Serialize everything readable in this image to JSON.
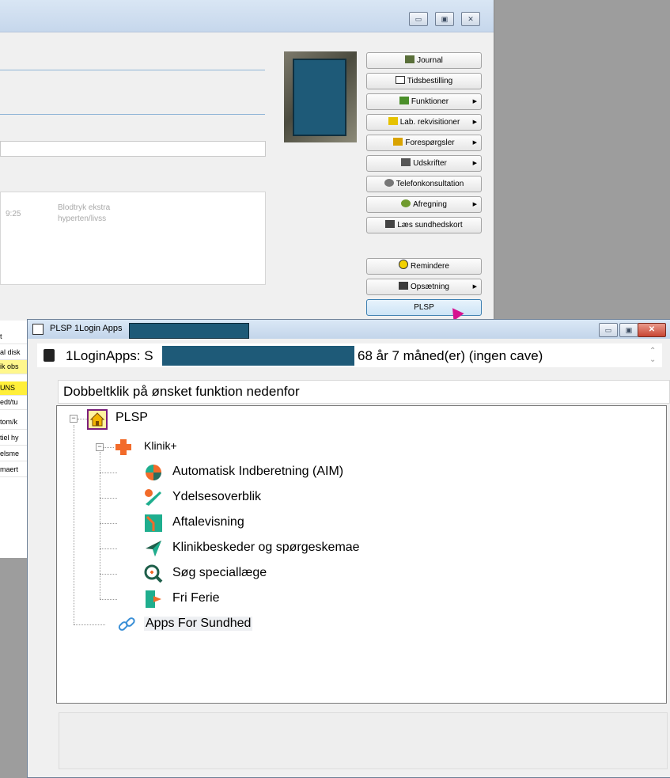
{
  "background_window": {
    "caption_buttons": [
      "▭",
      "▣",
      "✕"
    ],
    "note_time": "9:25",
    "note_text_line1": "Blodtryk ekstra",
    "note_text_line2": "hyperten/livss",
    "menu": [
      {
        "label": "Journal",
        "icon": "journal-icon",
        "arrow": false
      },
      {
        "label": "Tidsbestilling",
        "icon": "calendar-icon",
        "arrow": false
      },
      {
        "label": "Funktioner",
        "icon": "functions-icon",
        "arrow": true
      },
      {
        "label": "Lab. rekvisitioner",
        "icon": "lab-icon",
        "arrow": true
      },
      {
        "label": "Forespørgsler",
        "icon": "query-icon",
        "arrow": true
      },
      {
        "label": "Udskrifter",
        "icon": "printer-icon",
        "arrow": true
      },
      {
        "label": "Telefonkonsultation",
        "icon": "phone-icon",
        "arrow": false
      },
      {
        "label": "Afregning",
        "icon": "money-icon",
        "arrow": true
      },
      {
        "label": "Læs sundhedskort",
        "icon": "card-reader-icon",
        "arrow": false
      },
      {
        "label": "Remindere",
        "icon": "reminder-icon",
        "arrow": false
      },
      {
        "label": "Opsætning",
        "icon": "tools-icon",
        "arrow": true
      },
      {
        "label": "PLSP",
        "icon": "",
        "arrow": false
      }
    ],
    "left_strip": [
      "t",
      "al disk",
      "ik obs",
      "UNS",
      "edt/tu",
      "tom/k",
      "tiel hy",
      "elsme",
      "maert"
    ]
  },
  "popup": {
    "title": "PLSP 1Login Apps",
    "caption_buttons": [
      "▭",
      "▣",
      "✕"
    ],
    "info_prefix": "1LoginApps: S",
    "info_age": "68 år 7 måned(er) (ingen cave)",
    "instruction": "Dobbeltklik på ønsket funktion nedenfor",
    "tree": {
      "root": "PLSP",
      "group": "Klinik+",
      "children": [
        "Automatisk Indberetning (AIM)",
        "Ydelsesoverblik",
        "Aftalevisning",
        "Klinikbeskeder og spørgeskemae",
        "Søg speciallæge",
        "Fri Ferie"
      ],
      "sibling": "Apps For Sundhed"
    }
  },
  "colors": {
    "redaction": "#1e5a78",
    "accent_orange": "#f26b2a",
    "accent_teal": "#1fae8e"
  }
}
